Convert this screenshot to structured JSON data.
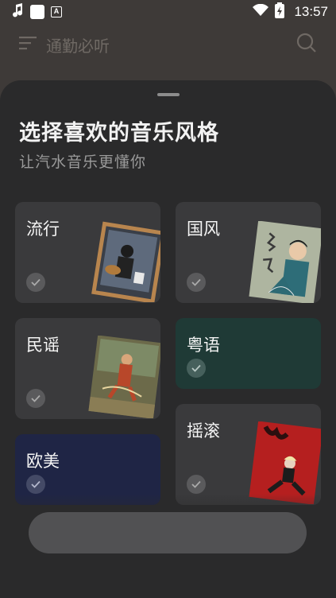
{
  "status_bar": {
    "time": "13:57",
    "left_icons": [
      "music-notification-icon",
      "app-notification-icon",
      "app-a-notification-icon"
    ],
    "right_icons": [
      "wifi-icon",
      "battery-charging-icon"
    ]
  },
  "background_header": {
    "title": "通勤必听",
    "icons": [
      "menu-icon",
      "search-icon"
    ]
  },
  "sheet": {
    "title": "选择喜欢的音乐风格",
    "subtitle": "让汽水音乐更懂你"
  },
  "genres": [
    {
      "label": "流行",
      "color": "#3a3a3c"
    },
    {
      "label": "国风",
      "color": "#3a3a3c"
    },
    {
      "label": "民谣",
      "color": "#3a3a3c"
    },
    {
      "label": "粤语",
      "color": "#1f3a36"
    },
    {
      "label": "欧美",
      "color": "#1f2545"
    },
    {
      "label": "摇滚",
      "color": "#3a3a3c"
    }
  ],
  "colors": {
    "sheet_bg": "#2a2a2b",
    "page_bg": "#3e3a38"
  }
}
